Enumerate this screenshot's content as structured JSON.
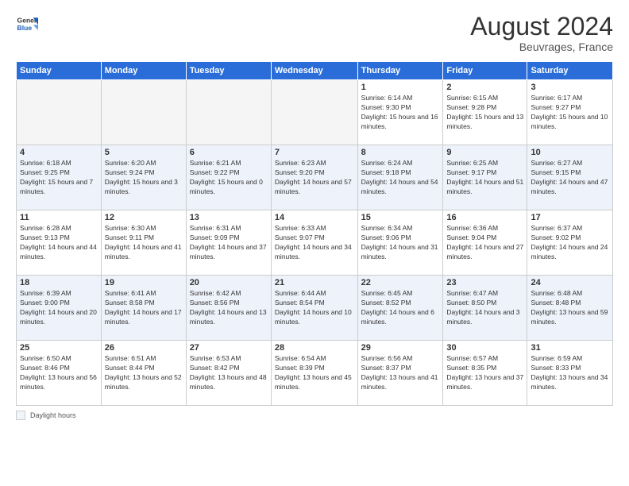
{
  "header": {
    "logo_general": "General",
    "logo_blue": "Blue",
    "month_year": "August 2024",
    "location": "Beuvrages, France"
  },
  "weekdays": [
    "Sunday",
    "Monday",
    "Tuesday",
    "Wednesday",
    "Thursday",
    "Friday",
    "Saturday"
  ],
  "footer": {
    "label": "Daylight hours"
  },
  "weeks": [
    [
      {
        "day": "",
        "sunrise": "",
        "sunset": "",
        "daylight": ""
      },
      {
        "day": "",
        "sunrise": "",
        "sunset": "",
        "daylight": ""
      },
      {
        "day": "",
        "sunrise": "",
        "sunset": "",
        "daylight": ""
      },
      {
        "day": "",
        "sunrise": "",
        "sunset": "",
        "daylight": ""
      },
      {
        "day": "1",
        "sunrise": "Sunrise: 6:14 AM",
        "sunset": "Sunset: 9:30 PM",
        "daylight": "Daylight: 15 hours and 16 minutes."
      },
      {
        "day": "2",
        "sunrise": "Sunrise: 6:15 AM",
        "sunset": "Sunset: 9:28 PM",
        "daylight": "Daylight: 15 hours and 13 minutes."
      },
      {
        "day": "3",
        "sunrise": "Sunrise: 6:17 AM",
        "sunset": "Sunset: 9:27 PM",
        "daylight": "Daylight: 15 hours and 10 minutes."
      }
    ],
    [
      {
        "day": "4",
        "sunrise": "Sunrise: 6:18 AM",
        "sunset": "Sunset: 9:25 PM",
        "daylight": "Daylight: 15 hours and 7 minutes."
      },
      {
        "day": "5",
        "sunrise": "Sunrise: 6:20 AM",
        "sunset": "Sunset: 9:24 PM",
        "daylight": "Daylight: 15 hours and 3 minutes."
      },
      {
        "day": "6",
        "sunrise": "Sunrise: 6:21 AM",
        "sunset": "Sunset: 9:22 PM",
        "daylight": "Daylight: 15 hours and 0 minutes."
      },
      {
        "day": "7",
        "sunrise": "Sunrise: 6:23 AM",
        "sunset": "Sunset: 9:20 PM",
        "daylight": "Daylight: 14 hours and 57 minutes."
      },
      {
        "day": "8",
        "sunrise": "Sunrise: 6:24 AM",
        "sunset": "Sunset: 9:18 PM",
        "daylight": "Daylight: 14 hours and 54 minutes."
      },
      {
        "day": "9",
        "sunrise": "Sunrise: 6:25 AM",
        "sunset": "Sunset: 9:17 PM",
        "daylight": "Daylight: 14 hours and 51 minutes."
      },
      {
        "day": "10",
        "sunrise": "Sunrise: 6:27 AM",
        "sunset": "Sunset: 9:15 PM",
        "daylight": "Daylight: 14 hours and 47 minutes."
      }
    ],
    [
      {
        "day": "11",
        "sunrise": "Sunrise: 6:28 AM",
        "sunset": "Sunset: 9:13 PM",
        "daylight": "Daylight: 14 hours and 44 minutes."
      },
      {
        "day": "12",
        "sunrise": "Sunrise: 6:30 AM",
        "sunset": "Sunset: 9:11 PM",
        "daylight": "Daylight: 14 hours and 41 minutes."
      },
      {
        "day": "13",
        "sunrise": "Sunrise: 6:31 AM",
        "sunset": "Sunset: 9:09 PM",
        "daylight": "Daylight: 14 hours and 37 minutes."
      },
      {
        "day": "14",
        "sunrise": "Sunrise: 6:33 AM",
        "sunset": "Sunset: 9:07 PM",
        "daylight": "Daylight: 14 hours and 34 minutes."
      },
      {
        "day": "15",
        "sunrise": "Sunrise: 6:34 AM",
        "sunset": "Sunset: 9:06 PM",
        "daylight": "Daylight: 14 hours and 31 minutes."
      },
      {
        "day": "16",
        "sunrise": "Sunrise: 6:36 AM",
        "sunset": "Sunset: 9:04 PM",
        "daylight": "Daylight: 14 hours and 27 minutes."
      },
      {
        "day": "17",
        "sunrise": "Sunrise: 6:37 AM",
        "sunset": "Sunset: 9:02 PM",
        "daylight": "Daylight: 14 hours and 24 minutes."
      }
    ],
    [
      {
        "day": "18",
        "sunrise": "Sunrise: 6:39 AM",
        "sunset": "Sunset: 9:00 PM",
        "daylight": "Daylight: 14 hours and 20 minutes."
      },
      {
        "day": "19",
        "sunrise": "Sunrise: 6:41 AM",
        "sunset": "Sunset: 8:58 PM",
        "daylight": "Daylight: 14 hours and 17 minutes."
      },
      {
        "day": "20",
        "sunrise": "Sunrise: 6:42 AM",
        "sunset": "Sunset: 8:56 PM",
        "daylight": "Daylight: 14 hours and 13 minutes."
      },
      {
        "day": "21",
        "sunrise": "Sunrise: 6:44 AM",
        "sunset": "Sunset: 8:54 PM",
        "daylight": "Daylight: 14 hours and 10 minutes."
      },
      {
        "day": "22",
        "sunrise": "Sunrise: 6:45 AM",
        "sunset": "Sunset: 8:52 PM",
        "daylight": "Daylight: 14 hours and 6 minutes."
      },
      {
        "day": "23",
        "sunrise": "Sunrise: 6:47 AM",
        "sunset": "Sunset: 8:50 PM",
        "daylight": "Daylight: 14 hours and 3 minutes."
      },
      {
        "day": "24",
        "sunrise": "Sunrise: 6:48 AM",
        "sunset": "Sunset: 8:48 PM",
        "daylight": "Daylight: 13 hours and 59 minutes."
      }
    ],
    [
      {
        "day": "25",
        "sunrise": "Sunrise: 6:50 AM",
        "sunset": "Sunset: 8:46 PM",
        "daylight": "Daylight: 13 hours and 56 minutes."
      },
      {
        "day": "26",
        "sunrise": "Sunrise: 6:51 AM",
        "sunset": "Sunset: 8:44 PM",
        "daylight": "Daylight: 13 hours and 52 minutes."
      },
      {
        "day": "27",
        "sunrise": "Sunrise: 6:53 AM",
        "sunset": "Sunset: 8:42 PM",
        "daylight": "Daylight: 13 hours and 48 minutes."
      },
      {
        "day": "28",
        "sunrise": "Sunrise: 6:54 AM",
        "sunset": "Sunset: 8:39 PM",
        "daylight": "Daylight: 13 hours and 45 minutes."
      },
      {
        "day": "29",
        "sunrise": "Sunrise: 6:56 AM",
        "sunset": "Sunset: 8:37 PM",
        "daylight": "Daylight: 13 hours and 41 minutes."
      },
      {
        "day": "30",
        "sunrise": "Sunrise: 6:57 AM",
        "sunset": "Sunset: 8:35 PM",
        "daylight": "Daylight: 13 hours and 37 minutes."
      },
      {
        "day": "31",
        "sunrise": "Sunrise: 6:59 AM",
        "sunset": "Sunset: 8:33 PM",
        "daylight": "Daylight: 13 hours and 34 minutes."
      }
    ]
  ]
}
